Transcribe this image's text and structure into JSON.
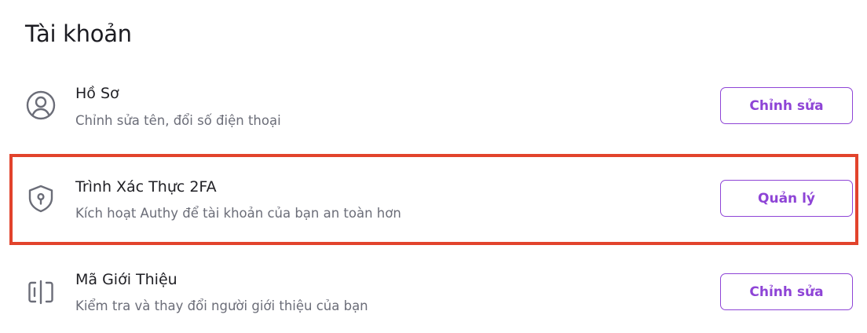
{
  "section": {
    "title": "Tài khoản"
  },
  "rows": [
    {
      "icon": "user-circle-icon",
      "title": "Hồ Sơ",
      "subtitle": "Chỉnh sửa tên, đổi số điện thoại",
      "button_label": "Chỉnh sửa"
    },
    {
      "icon": "shield-keyhole-icon",
      "title": "Trình Xác Thực 2FA",
      "subtitle": "Kích hoạt Authy để tài khoản của bạn an toàn hơn",
      "button_label": "Quản lý"
    },
    {
      "icon": "referral-card-icon",
      "title": "Mã Giới Thiệu",
      "subtitle": "Kiểm tra và thay đổi người giới thiệu của bạn",
      "button_label": "Chỉnh sửa"
    }
  ],
  "colors": {
    "accent": "#8e44d6",
    "highlight_border": "#e2432c",
    "icon": "#6b6d78",
    "subtitle": "#6b6d78"
  }
}
